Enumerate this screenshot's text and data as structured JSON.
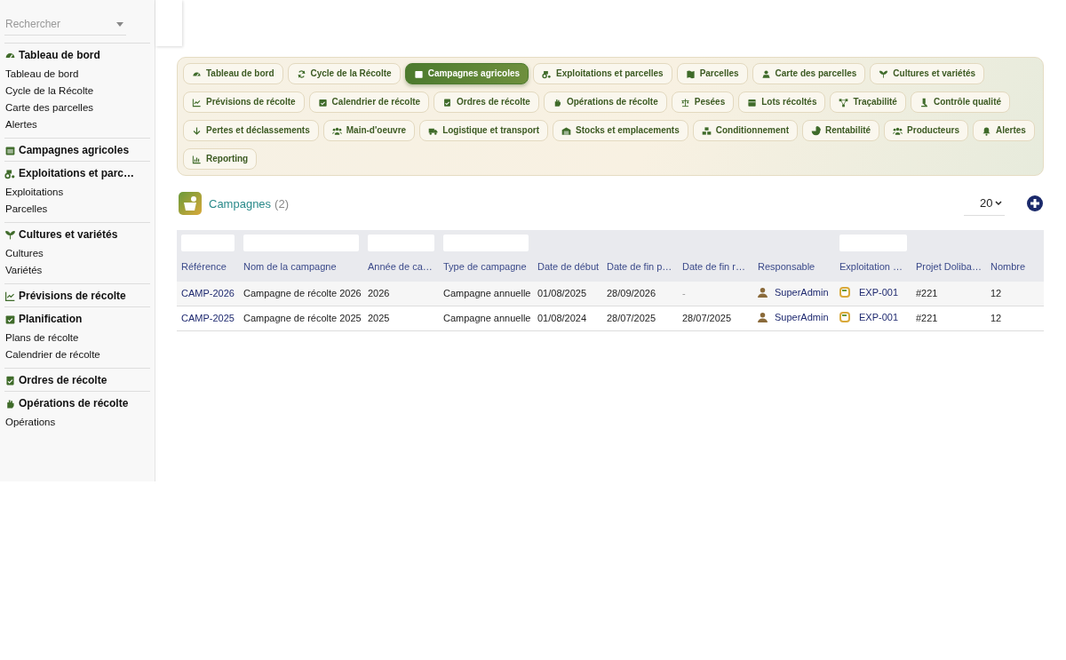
{
  "sidebar": {
    "search": {
      "placeholder": "Rechercher"
    },
    "sections": [
      {
        "title": "Tableau de bord",
        "items": [
          {
            "label": "Tableau de bord"
          },
          {
            "label": "Cycle de la Récolte"
          },
          {
            "label": "Carte des parcelles"
          },
          {
            "label": "Alertes"
          }
        ]
      },
      {
        "title": "Campagnes agricoles"
      },
      {
        "title": "Exploitations et parc…",
        "items": [
          {
            "label": "Exploitations"
          },
          {
            "label": "Parcelles"
          }
        ]
      },
      {
        "title": "Cultures et variétés",
        "items": [
          {
            "label": "Cultures"
          },
          {
            "label": "Variétés"
          }
        ]
      },
      {
        "title": "Prévisions de récolte"
      },
      {
        "title": "Planification",
        "items": [
          {
            "label": "Plans de récolte"
          },
          {
            "label": "Calendrier de récolte"
          }
        ]
      },
      {
        "title": "Ordres de récolte"
      },
      {
        "title": "Opérations de récolte",
        "items": [
          {
            "label": "Opérations"
          }
        ]
      }
    ]
  },
  "tabs": [
    {
      "label": "Tableau de bord",
      "selected": false
    },
    {
      "label": "Cycle de la Récolte",
      "selected": false
    },
    {
      "label": "Campagnes agricoles",
      "selected": true
    },
    {
      "label": "Exploitations et parcelles",
      "selected": false
    },
    {
      "label": "Parcelles",
      "selected": false
    },
    {
      "label": "Carte des parcelles",
      "selected": false
    },
    {
      "label": "Cultures et variétés",
      "selected": false
    },
    {
      "label": "Prévisions de récolte",
      "selected": false
    },
    {
      "label": "Calendrier de récolte",
      "selected": false
    },
    {
      "label": "Ordres de récolte",
      "selected": false
    },
    {
      "label": "Opérations de récolte",
      "selected": false
    },
    {
      "label": "Pesées",
      "selected": false
    },
    {
      "label": "Lots récoltés",
      "selected": false
    },
    {
      "label": "Traçabilité",
      "selected": false
    },
    {
      "label": "Contrôle qualité",
      "selected": false
    },
    {
      "label": "Pertes et déclassements",
      "selected": false
    },
    {
      "label": "Main-d'oeuvre",
      "selected": false
    },
    {
      "label": "Logistique et transport",
      "selected": false
    },
    {
      "label": "Stocks et emplacements",
      "selected": false
    },
    {
      "label": "Conditionnement",
      "selected": false
    },
    {
      "label": "Rentabilité",
      "selected": false
    },
    {
      "label": "Producteurs",
      "selected": false
    },
    {
      "label": "Alertes",
      "selected": false
    },
    {
      "label": "Reporting",
      "selected": false
    }
  ],
  "list": {
    "title": "Campagnes",
    "count": "(2)",
    "page_size": "20",
    "table": {
      "columns": [
        {
          "label": "Référence",
          "filter": true
        },
        {
          "label": "Nom de la campagne",
          "filter": true
        },
        {
          "label": "Année de ca…",
          "filter": true
        },
        {
          "label": "Type de campagne",
          "filter": true
        },
        {
          "label": "Date de début",
          "filter": false
        },
        {
          "label": "Date de fin p…",
          "filter": false
        },
        {
          "label": "Date de fin r…",
          "filter": false
        },
        {
          "label": "Responsable",
          "filter": false
        },
        {
          "label": "Exploitation …",
          "filter": true
        },
        {
          "label": "Projet Doliba…",
          "filter": false
        },
        {
          "label": "Nombre",
          "filter": false
        }
      ],
      "rows": [
        [
          "CAMP-2026",
          "Campagne de récolte 2026",
          "2026",
          "Campagne annuelle",
          "01/08/2025",
          "28/09/2026",
          "-",
          "SuperAdmin",
          "EXP-001",
          "#221",
          "12"
        ],
        [
          "CAMP-2025",
          "Campagne de récolte 2025",
          "2025",
          "Campagne annuelle",
          "01/08/2024",
          "28/07/2025",
          "28/07/2025",
          "SuperAdmin",
          "EXP-001",
          "#221",
          "12"
        ]
      ]
    }
  }
}
